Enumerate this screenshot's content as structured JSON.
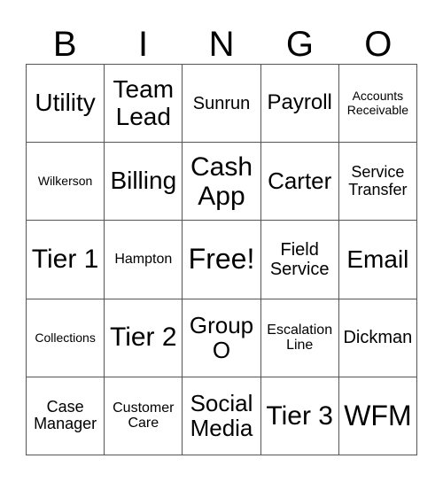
{
  "header": [
    "B",
    "I",
    "N",
    "G",
    "O"
  ],
  "cells": [
    "Utility",
    "Team Lead",
    "Sunrun",
    "Payroll",
    "Accounts Receivable",
    "Wilkerson",
    "Billing",
    "Cash App",
    "Carter",
    "Service Transfer",
    "Tier 1",
    "Hampton",
    "Free!",
    "Field Service",
    "Email",
    "Collections",
    "Tier 2",
    "Group O",
    "Escalation Line",
    "Dickman",
    "Case Manager",
    "Customer Care",
    "Social Media",
    "Tier 3",
    "WFM"
  ]
}
